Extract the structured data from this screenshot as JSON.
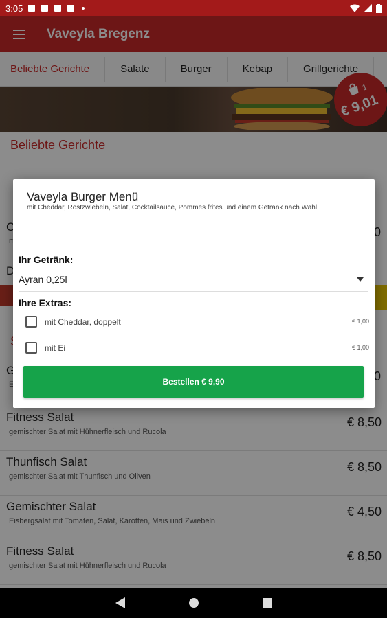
{
  "status": {
    "time": "3:05"
  },
  "appbar": {
    "title": "Vaveyla Bregenz",
    "menu_icon": "hamburger-menu-icon"
  },
  "tabs": [
    "Beliebte Gerichte",
    "Salate",
    "Burger",
    "Kebap",
    "Grillgerichte"
  ],
  "cart": {
    "count": "1",
    "total": "€ 9,01"
  },
  "section": {
    "title": "Beliebte Gerichte"
  },
  "partial_items": {
    "row1_name": "C",
    "row1_desc": "m",
    "row1_price": "0",
    "row2_name": "D",
    "row3_marker": "S",
    "row4_name": "G",
    "row4_desc": "E",
    "row4_price": "0"
  },
  "items": [
    {
      "name": "Fitness Salat",
      "desc": "gemischter Salat mit Hühnerfleisch und Rucola",
      "price": "€ 8,50"
    },
    {
      "name": "Thunfisch Salat",
      "desc": "gemischter Salat mit Thunfisch und Oliven",
      "price": "€ 8,50"
    },
    {
      "name": "Gemischter Salat",
      "desc": "Eisbergsalat mit Tomaten, Salat, Karotten, Mais und Zwiebeln",
      "price": "€ 4,50"
    },
    {
      "name": "Fitness Salat",
      "desc": "gemischter Salat mit Hühnerfleisch und Rucola",
      "price": "€ 8,50"
    }
  ],
  "dialog": {
    "title": "Vaveyla Burger Menü",
    "description": "mit Cheddar, Röstzwiebeln, Salat, Cocktailsauce, Pommes frites und einem Getränk nach Wahl",
    "drink_label": "Ihr Getränk:",
    "drink_value": "Ayran 0,25l",
    "extras_label": "Ihre Extras:",
    "extras": [
      {
        "label": "mit Cheddar, doppelt",
        "price": "€ 1,00",
        "checked": false
      },
      {
        "label": "mit Ei",
        "price": "€ 1,00",
        "checked": false
      }
    ],
    "order_button": "Bestellen € 9,90"
  },
  "colors": {
    "primary": "#c62828",
    "status": "#a31a1a",
    "order": "#16a34a"
  }
}
